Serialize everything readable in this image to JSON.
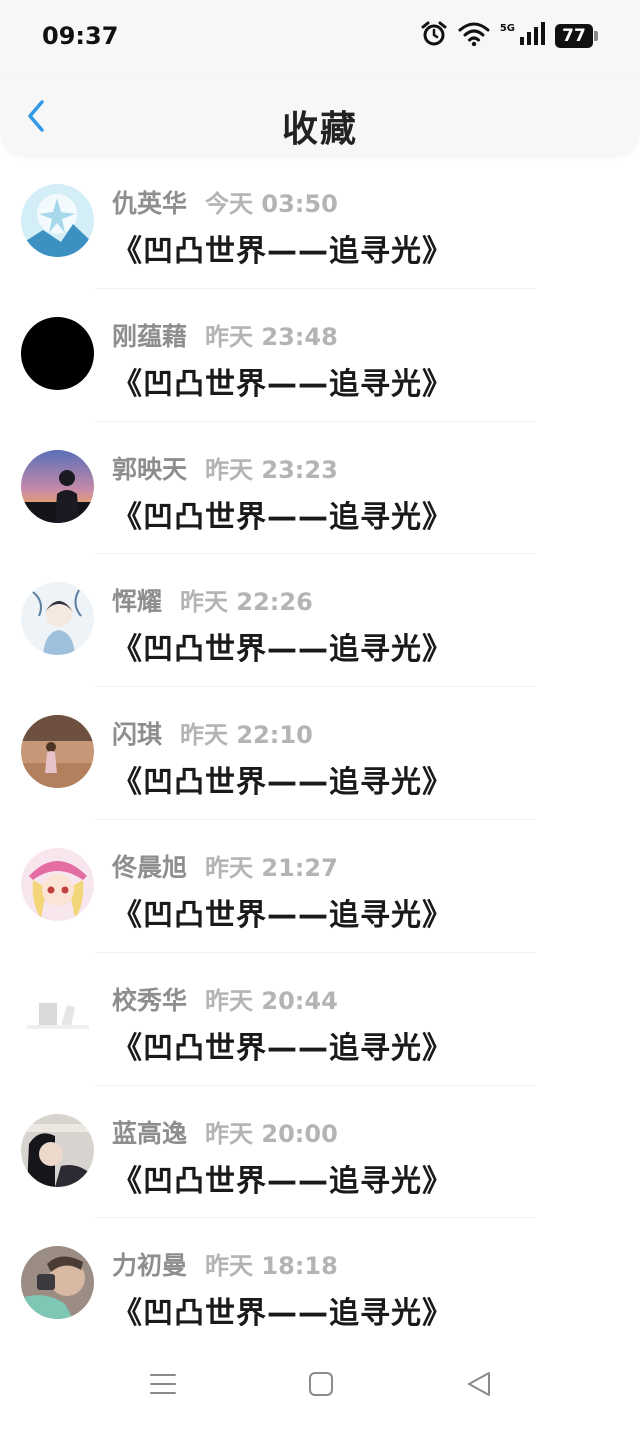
{
  "status_bar": {
    "time": "09:37",
    "network": "5G",
    "battery": "77",
    "icons": [
      "alarm-icon",
      "wifi-icon",
      "signal-icon",
      "battery-icon"
    ]
  },
  "header": {
    "title": "收藏",
    "back_icon": "chevron-left-icon",
    "accent_color": "#2f9be8"
  },
  "favorites": [
    {
      "name": "仇英华",
      "time": "今天 03:50",
      "title": "《凹凸世界——追寻光》"
    },
    {
      "name": "刚蕴藉",
      "time": "昨天 23:48",
      "title": "《凹凸世界——追寻光》"
    },
    {
      "name": "郭映天",
      "time": "昨天 23:23",
      "title": "《凹凸世界——追寻光》"
    },
    {
      "name": "恽耀",
      "time": "昨天 22:26",
      "title": "《凹凸世界——追寻光》"
    },
    {
      "name": "闪琪",
      "time": "昨天 22:10",
      "title": "《凹凸世界——追寻光》"
    },
    {
      "name": "佟晨旭",
      "time": "昨天 21:27",
      "title": "《凹凸世界——追寻光》"
    },
    {
      "name": "校秀华",
      "time": "昨天 20:44",
      "title": "《凹凸世界——追寻光》"
    },
    {
      "name": "蓝高逸",
      "time": "昨天 20:00",
      "title": "《凹凸世界——追寻光》"
    },
    {
      "name": "力初曼",
      "time": "昨天 18:18",
      "title": "《凹凸世界——追寻光》"
    }
  ],
  "system_nav": {
    "icons": [
      "menu-icon",
      "home-square-icon",
      "back-triangle-icon"
    ]
  }
}
